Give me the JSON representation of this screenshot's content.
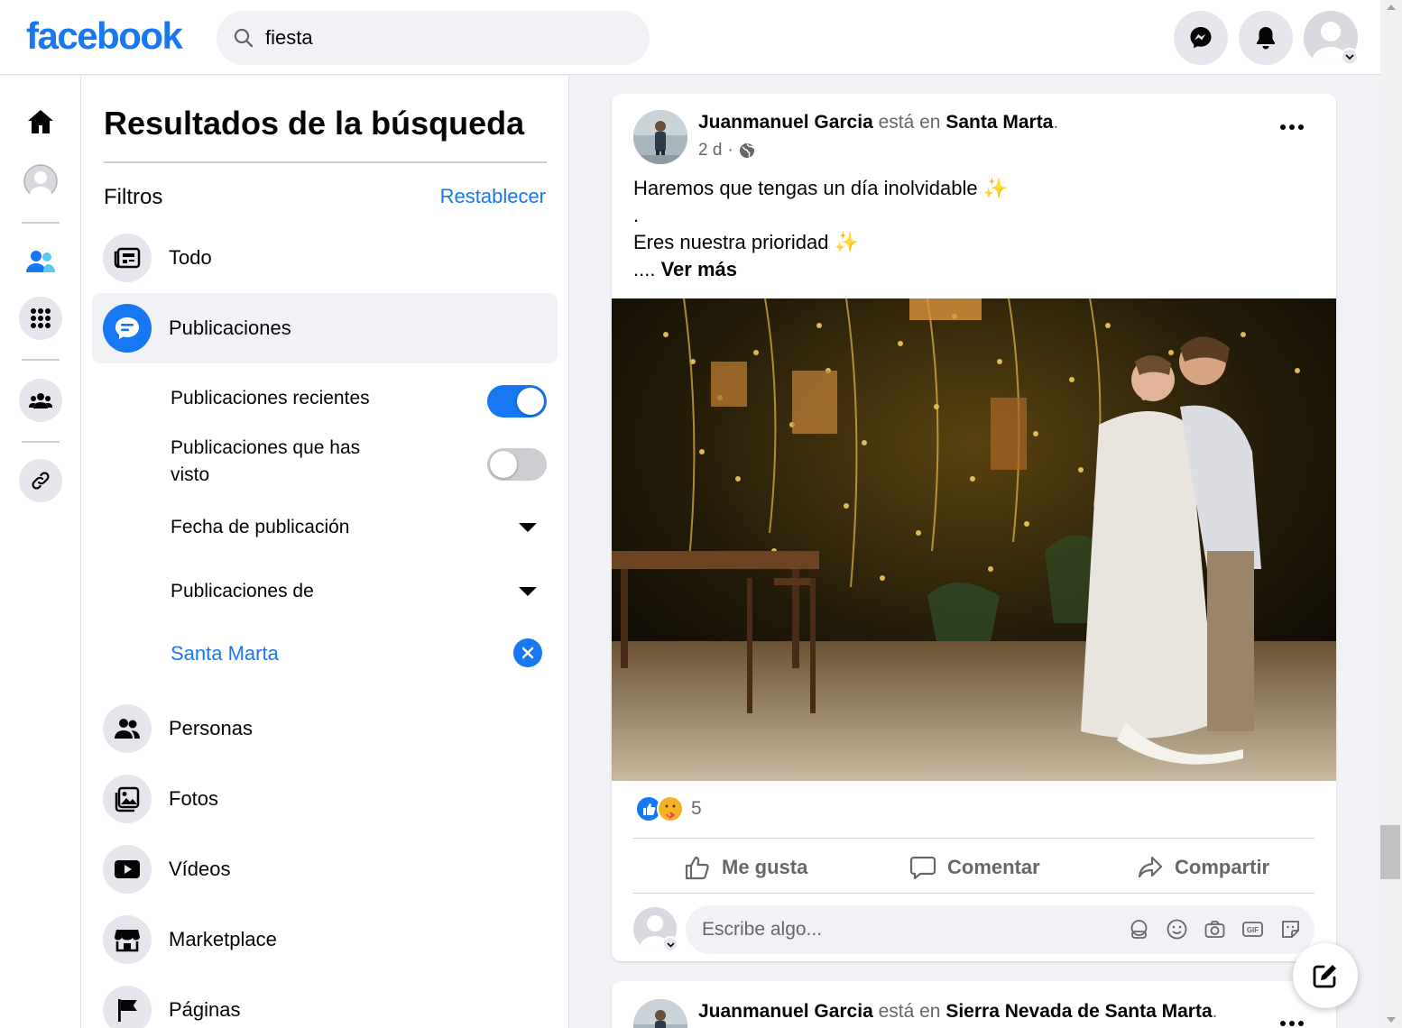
{
  "header": {
    "logo": "facebook",
    "search_value": "fiesta"
  },
  "filters_panel": {
    "title": "Resultados de la búsqueda",
    "filters_label": "Filtros",
    "reset_label": "Restablecer",
    "categories": [
      {
        "label": "Todo",
        "icon": "news-feed-icon"
      },
      {
        "label": "Publicaciones",
        "icon": "chat-bubble-icon",
        "active": true
      },
      {
        "label": "Personas",
        "icon": "people-icon"
      },
      {
        "label": "Fotos",
        "icon": "photos-icon"
      },
      {
        "label": "Vídeos",
        "icon": "video-play-icon"
      },
      {
        "label": "Marketplace",
        "icon": "shop-icon"
      },
      {
        "label": "Páginas",
        "icon": "flag-icon"
      }
    ],
    "post_filters": {
      "recent_label": "Publicaciones recientes",
      "recent_on": true,
      "seen_label_line1": "Publicaciones que has",
      "seen_label_line2": "visto",
      "seen_on": false,
      "date_label": "Fecha de publicación",
      "from_label": "Publicaciones de",
      "location_value": "Santa Marta"
    }
  },
  "post": {
    "author": "Juanmanuel Garcia",
    "connector": "está en",
    "location": "Santa Marta",
    "period": ".",
    "time": "2 d",
    "dot": "·",
    "privacy_icon": "globe-icon",
    "text_line1": "Haremos que tengas un día inolvidable",
    "sparkle": "✨",
    "text_line2": ".",
    "text_line3": "Eres nuestra prioridad",
    "ellipsis": "....",
    "see_more": "Ver más",
    "reaction_count": "5",
    "reaction_icons": [
      "like-icon",
      "care-icon"
    ],
    "actions": {
      "like": "Me gusta",
      "comment": "Comentar",
      "share": "Compartir"
    },
    "comment_placeholder": "Escribe algo..."
  },
  "next_post": {
    "author": "Juanmanuel Garcia",
    "connector": "está en",
    "location": "Sierra Nevada de Santa Marta",
    "period": "."
  },
  "colors": {
    "brand": "#1877f2",
    "background": "#f0f2f5",
    "text_secondary": "#65676b"
  }
}
